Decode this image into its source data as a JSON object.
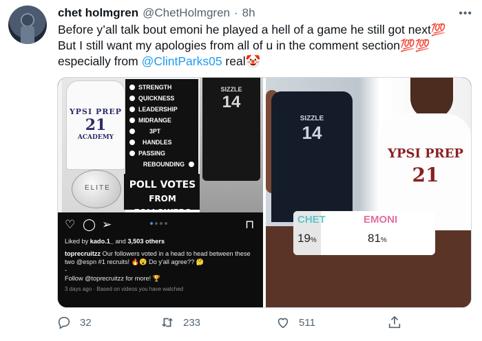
{
  "tweet": {
    "author_name": "chet holmgren",
    "author_handle": "@ChetHolmgren",
    "separator": "·",
    "time": "8h",
    "text_line1": "Before y’all talk bout emoni he played a hell of a game he still got next💯",
    "text_line2": "But I still want my apologies from all of u in the comment section💯💯",
    "text_line3_prefix": "especially from ",
    "mention": "@ClintParks05",
    "text_line3_suffix": " real🤡",
    "more_icon": "more-dots-icon"
  },
  "instagram_post": {
    "stats_labels": [
      "STRENGTH",
      "QUICKNESS",
      "LEADERSHIP",
      "MIDRANGE",
      "3PT",
      "HANDLES",
      "PASSING",
      "REBOUNDING"
    ],
    "poll_title_line1": "POLL VOTES",
    "poll_title_line2": "FROM FOLLOWERS",
    "left_jersey_school": "YPSI PREP",
    "left_jersey_number": "21",
    "left_jersey_sub": "ACADEMY",
    "ball_text": "ELITE",
    "right_jersey_name": "SIZZLE",
    "right_jersey_number": "14",
    "liked_by_prefix": "Liked by ",
    "liked_by_user": "kado.1_",
    "liked_by_middle": " and ",
    "liked_by_count": "3,503 others",
    "caption_user": "toprecruitzz",
    "caption_text": " Our followers voted in a head to head between these two @espn #1 recruits! 🔥😮 Do y'all agree?? 🤔",
    "caption_dash": "-",
    "caption_follow": "Follow @toprecruitzz for more! 🏆",
    "timestamp": "3 days ago · Based on videos you have watched"
  },
  "poll_image": {
    "left_jersey_name": "SIZZLE",
    "left_jersey_number": "14",
    "right_jersey_school": "YPSI PREP",
    "right_jersey_number": "21",
    "option_a": "CHET",
    "option_b": "EMONI",
    "percent_a": "19",
    "percent_b": "81",
    "percent_sign": "%",
    "option_a_color": "#5ec5c9",
    "option_b_color": "#e26fa0"
  },
  "actions": {
    "reply_count": "32",
    "retweet_count": "233",
    "like_count": "511"
  },
  "colors": {
    "link": "#1d9bf0",
    "muted": "#536471"
  }
}
